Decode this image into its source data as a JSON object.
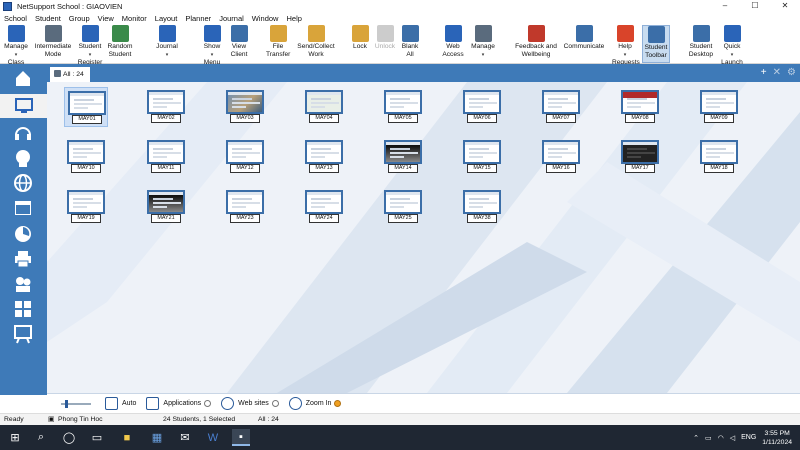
{
  "window": {
    "title": "NetSupport School : GIAOVIEN",
    "controls": [
      "–",
      "☐",
      "✕"
    ]
  },
  "menu": [
    "School",
    "Student",
    "Group",
    "View",
    "Monitor",
    "Layout",
    "Planner",
    "Journal",
    "Window",
    "Help"
  ],
  "toolbar": [
    {
      "label1": "Manage",
      "label2": "Class",
      "dd": true,
      "icon": "manage-class-icon",
      "color": "#2a64b8"
    },
    {
      "label1": "Intermediate",
      "label2": "Mode",
      "dd": false,
      "icon": "intermediate-mode-icon",
      "color": "#5a6b7d"
    },
    {
      "label1": "Student",
      "label2": "Register",
      "dd": true,
      "icon": "student-register-icon",
      "color": "#2a64b8"
    },
    {
      "label1": "Random",
      "label2": "Student",
      "dd": false,
      "icon": "random-student-icon",
      "color": "#3a8a4a"
    },
    {
      "label1": "Journal",
      "label2": "",
      "dd": true,
      "icon": "journal-icon",
      "color": "#2a64b8"
    },
    {
      "label1": "Show",
      "label2": "Menu",
      "dd": true,
      "icon": "show-menu-icon",
      "color": "#2a64b8"
    },
    {
      "label1": "View",
      "label2": "Client",
      "dd": false,
      "icon": "view-client-icon",
      "color": "#3b6ea8"
    },
    {
      "label1": "File",
      "label2": "Transfer",
      "dd": false,
      "icon": "file-transfer-icon",
      "color": "#d9a43a"
    },
    {
      "label1": "Send/Collect",
      "label2": "Work",
      "dd": false,
      "icon": "send-collect-icon",
      "color": "#d9a43a"
    },
    {
      "label1": "Lock",
      "label2": "",
      "dd": false,
      "icon": "lock-icon",
      "color": "#d9a43a"
    },
    {
      "label1": "Unlock",
      "label2": "",
      "dd": false,
      "icon": "unlock-icon",
      "color": "#cccccc",
      "disabled": true
    },
    {
      "label1": "Blank",
      "label2": "All",
      "dd": false,
      "icon": "blank-all-icon",
      "color": "#3b6ea8"
    },
    {
      "label1": "Web",
      "label2": "Access",
      "dd": false,
      "icon": "web-access-icon",
      "color": "#2a64b8"
    },
    {
      "label1": "Manage",
      "label2": "",
      "dd": true,
      "icon": "manage-icon",
      "color": "#5a6b7d"
    },
    {
      "label1": "Feedback and",
      "label2": "Wellbeing",
      "dd": false,
      "icon": "feedback-icon",
      "color": "#c0392b"
    },
    {
      "label1": "Communicate",
      "label2": "",
      "dd": false,
      "icon": "communicate-icon",
      "color": "#3b6ea8"
    },
    {
      "label1": "Help",
      "label2": "Requests",
      "dd": true,
      "icon": "help-requests-icon",
      "color": "#d9442a"
    },
    {
      "label1": "Student",
      "label2": "Toolbar",
      "dd": false,
      "icon": "student-toolbar-icon",
      "color": "#3b6ea8",
      "selected": true
    },
    {
      "label1": "Student",
      "label2": "Desktop",
      "dd": false,
      "icon": "student-desktop-icon",
      "color": "#3b6ea8"
    },
    {
      "label1": "Quick",
      "label2": "Launch",
      "dd": true,
      "icon": "quick-launch-icon",
      "color": "#2a64b8"
    }
  ],
  "leftnav": [
    {
      "name": "home-icon",
      "active": false
    },
    {
      "name": "monitor-icon",
      "active": true
    },
    {
      "name": "headset-icon",
      "active": false
    },
    {
      "name": "student-head-icon",
      "active": false
    },
    {
      "name": "globe-icon",
      "active": false
    },
    {
      "name": "window-icon",
      "active": false
    },
    {
      "name": "clock-pie-icon",
      "active": false
    },
    {
      "name": "printer-icon",
      "active": false
    },
    {
      "name": "group-icon",
      "active": false
    },
    {
      "name": "quiz-icon",
      "active": false
    },
    {
      "name": "whiteboard-icon",
      "active": false
    }
  ],
  "tab": {
    "label": "All : 24"
  },
  "tabtools": [
    "+",
    "✕",
    "⚙"
  ],
  "students": [
    {
      "name": "MAY01",
      "style": "plain",
      "selected": true
    },
    {
      "name": "MAY02",
      "style": "plain"
    },
    {
      "name": "MAY03",
      "style": "photo"
    },
    {
      "name": "MAY04",
      "style": "greenish"
    },
    {
      "name": "MAY05",
      "style": "plain"
    },
    {
      "name": "MAY06",
      "style": "plain"
    },
    {
      "name": "MAY07",
      "style": "plain"
    },
    {
      "name": "MAY08",
      "style": "red"
    },
    {
      "name": "MAY09",
      "style": "plain"
    },
    {
      "name": "MAY10",
      "style": "plain"
    },
    {
      "name": "MAY11",
      "style": "plain"
    },
    {
      "name": "MAY12",
      "style": "plain"
    },
    {
      "name": "MAY13",
      "style": "plain"
    },
    {
      "name": "MAY14",
      "style": "gradient"
    },
    {
      "name": "MAY15",
      "style": "plain"
    },
    {
      "name": "MAY16",
      "style": "plain"
    },
    {
      "name": "MAY17",
      "style": "dark"
    },
    {
      "name": "MAY18",
      "style": "plain"
    },
    {
      "name": "MAY19",
      "style": "plain"
    },
    {
      "name": "MAY21",
      "style": "gradient"
    },
    {
      "name": "MAY23",
      "style": "plain"
    },
    {
      "name": "MAY24",
      "style": "plain"
    },
    {
      "name": "MAY25",
      "style": "plain"
    },
    {
      "name": "MAY38",
      "style": "plain"
    }
  ],
  "options": {
    "auto": "Auto",
    "applications": "Applications",
    "websites": "Web sites",
    "zoom": "Zoom In"
  },
  "status": {
    "ready": "Ready",
    "room": "Phong Tin Hoc",
    "selection": "24 Students, 1 Selected",
    "group": "All : 24"
  },
  "taskbar": {
    "lang": "ENG",
    "time": "3:55 PM",
    "date": "1/11/2024"
  },
  "colors": {
    "nav": "#3e7ab8",
    "accent": "#2a64b8",
    "taskbar": "#1f2733"
  }
}
